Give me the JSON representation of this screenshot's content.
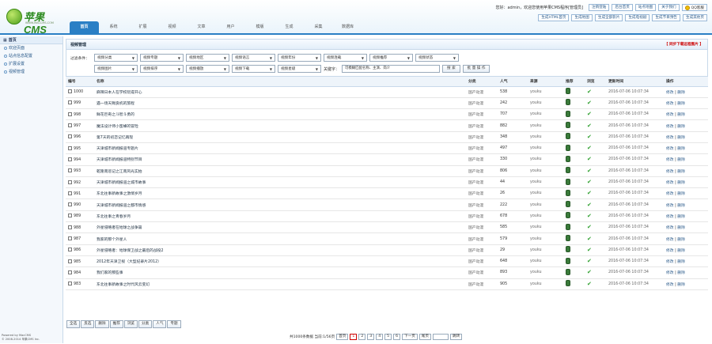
{
  "brand": {
    "name": "苹果CMS",
    "sub": "WWW.MACCMS.COM"
  },
  "topbar": {
    "welcome": "您好：admin，欢迎您使用苹果CMS程序[管理员]",
    "links": [
      "注销登陆",
      "后台首页",
      "站点地图",
      "关于我们"
    ],
    "qq": "QQ客服",
    "links2": [
      "生成HTML首页",
      "生成地图",
      "生成全部影片",
      "生成电视剧",
      "生成节目预告",
      "生成其他页"
    ]
  },
  "tabs": [
    "首页",
    "系统",
    "扩展",
    "视频",
    "文章",
    "用户",
    "模版",
    "生成",
    "采集",
    "数据库"
  ],
  "sidebar": {
    "title": "首页",
    "items": [
      "欢迎页面",
      "站点信息配置",
      "扩展设置",
      "视频管理"
    ]
  },
  "powered": [
    "Powered by MacCMS",
    "© 2008-2014 苹果CMS Inc."
  ],
  "panel": {
    "title": "视频管理",
    "right": "【 同步下载远程图片 】"
  },
  "filter": {
    "label": "过滤条件：",
    "row1": [
      "视频分类",
      "视频专题",
      "视频地区",
      "视频语言",
      "视频年份",
      "视频连载",
      "视频推荐",
      "视频状态"
    ],
    "row2": [
      "视频图片",
      "视频排序",
      "视频播放",
      "视频下载",
      "视频星级"
    ],
    "kw_label": "关键字：",
    "kw_value": "可模糊匹配名称、主演、简介",
    "search": "搜 索",
    "batch": "批 量 操 作"
  },
  "columns": [
    "编号",
    "名称",
    "分类",
    "人气",
    "来源",
    "推荐",
    "浏览",
    "更新时间",
    "操作"
  ],
  "rows": [
    {
      "id": "1000",
      "name": "麻辣日本人在学校玩得开心",
      "cat": "国产动漫",
      "hits": "538",
      "src": "youku",
      "time": "2016-07-06 10:07:34"
    },
    {
      "id": "999",
      "name": "遇一场天赐良机的旅程",
      "cat": "国产动漫",
      "hits": "242",
      "src": "youku",
      "time": "2016-07-06 10:07:34"
    },
    {
      "id": "998",
      "name": "鲜花巨奇之斗智斗勇的",
      "cat": "国产动漫",
      "hits": "707",
      "src": "youku",
      "time": "2016-07-06 10:07:34"
    },
    {
      "id": "997",
      "name": "魔法设计师小蜜蜂的冒险",
      "cat": "国产动漫",
      "hits": "882",
      "src": "youku",
      "time": "2016-07-06 10:07:34"
    },
    {
      "id": "996",
      "name": "第7天的初恋记忆再现",
      "cat": "国产动漫",
      "hits": "348",
      "src": "youku",
      "time": "2016-07-06 10:07:34"
    },
    {
      "id": "995",
      "name": "天津城市新闻报道专题片",
      "cat": "国产动漫",
      "hits": "497",
      "src": "youku",
      "time": "2016-07-06 10:07:34"
    },
    {
      "id": "994",
      "name": "天津城市新闻报道特别节目",
      "cat": "国产动漫",
      "hits": "330",
      "src": "youku",
      "time": "2016-07-06 10:07:34"
    },
    {
      "id": "993",
      "name": "乾隆南巡记之江南风光实拍",
      "cat": "国产动漫",
      "hits": "806",
      "src": "youku",
      "time": "2016-07-06 10:07:34"
    },
    {
      "id": "992",
      "name": "天津城市新闻报道之城市故事",
      "cat": "国产动漫",
      "hits": "44",
      "src": "youku",
      "time": "2016-07-06 10:07:34"
    },
    {
      "id": "991",
      "name": "东北往事新故事之激情岁月",
      "cat": "国产动漫",
      "hits": "26",
      "src": "youku",
      "time": "2016-07-06 10:07:34"
    },
    {
      "id": "990",
      "name": "天津城市新闻报道之都市情感",
      "cat": "国产动漫",
      "hits": "222",
      "src": "youku",
      "time": "2016-07-06 10:07:34"
    },
    {
      "id": "989",
      "name": "东北往事之青春岁月",
      "cat": "国产动漫",
      "hits": "678",
      "src": "youku",
      "time": "2016-07-06 10:07:34"
    },
    {
      "id": "988",
      "name": "外星侵略者在地球之战争篇",
      "cat": "国产动漫",
      "hits": "585",
      "src": "youku",
      "time": "2016-07-06 10:07:34"
    },
    {
      "id": "987",
      "name": "我家的那个外星人",
      "cat": "国产动漫",
      "hits": "579",
      "src": "youku",
      "time": "2016-07-06 10:07:34"
    },
    {
      "id": "986",
      "name": "外星侵略者：地球保卫战之最后的战役2",
      "cat": "国产动漫",
      "hits": "29",
      "src": "youku",
      "time": "2016-07-06 10:07:34"
    },
    {
      "id": "985",
      "name": "2012年天津卫视（大型纪录片2012）",
      "cat": "国产动漫",
      "hits": "648",
      "src": "youku",
      "time": "2016-07-06 10:07:34"
    },
    {
      "id": "984",
      "name": "我们家的那些事",
      "cat": "国产动漫",
      "hits": "893",
      "src": "youku",
      "time": "2016-07-06 10:07:34"
    },
    {
      "id": "983",
      "name": "东北往事新故事之时代风云变幻",
      "cat": "国产动漫",
      "hits": "905",
      "src": "youku",
      "time": "2016-07-06 10:07:34"
    }
  ],
  "ops": {
    "edit": "修改",
    "del": "删除"
  },
  "bottom_btns": [
    "全选",
    "反选",
    "删除",
    "推荐",
    "浏览",
    "分类",
    "人气",
    "专题"
  ],
  "pager": {
    "info": "共1000条数据 当前:1/56页",
    "first": "首页",
    "pages": [
      "1",
      "2",
      "3",
      "4",
      "5",
      "6"
    ],
    "next": "下一页",
    "last": "尾页",
    "go": "跳转"
  },
  "colors": {
    "accent": "#2a7fc5",
    "brand": "#2c8a1f"
  }
}
